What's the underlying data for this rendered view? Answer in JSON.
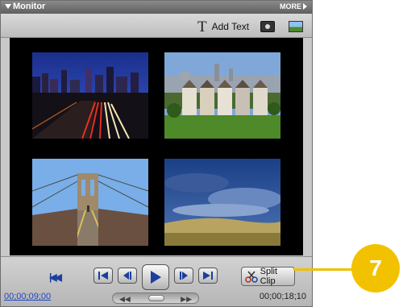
{
  "window": {
    "title": "Monitor",
    "more_label": "MORE"
  },
  "toolbar": {
    "add_text_label": "Add Text"
  },
  "preview": {
    "thumbnails": [
      {
        "name": "night-city-traffic"
      },
      {
        "name": "victorian-houses-skyline"
      },
      {
        "name": "suspension-bridge-walkway"
      },
      {
        "name": "stormy-sky-field"
      }
    ]
  },
  "controls": {
    "current_time": "00;00;09;00",
    "total_time": "00;00;18;10",
    "split_clip_label": "Split Clip"
  },
  "callout": {
    "number": "7"
  },
  "colors": {
    "callout": "#f2c200",
    "timecode_link": "#1f47c0"
  }
}
